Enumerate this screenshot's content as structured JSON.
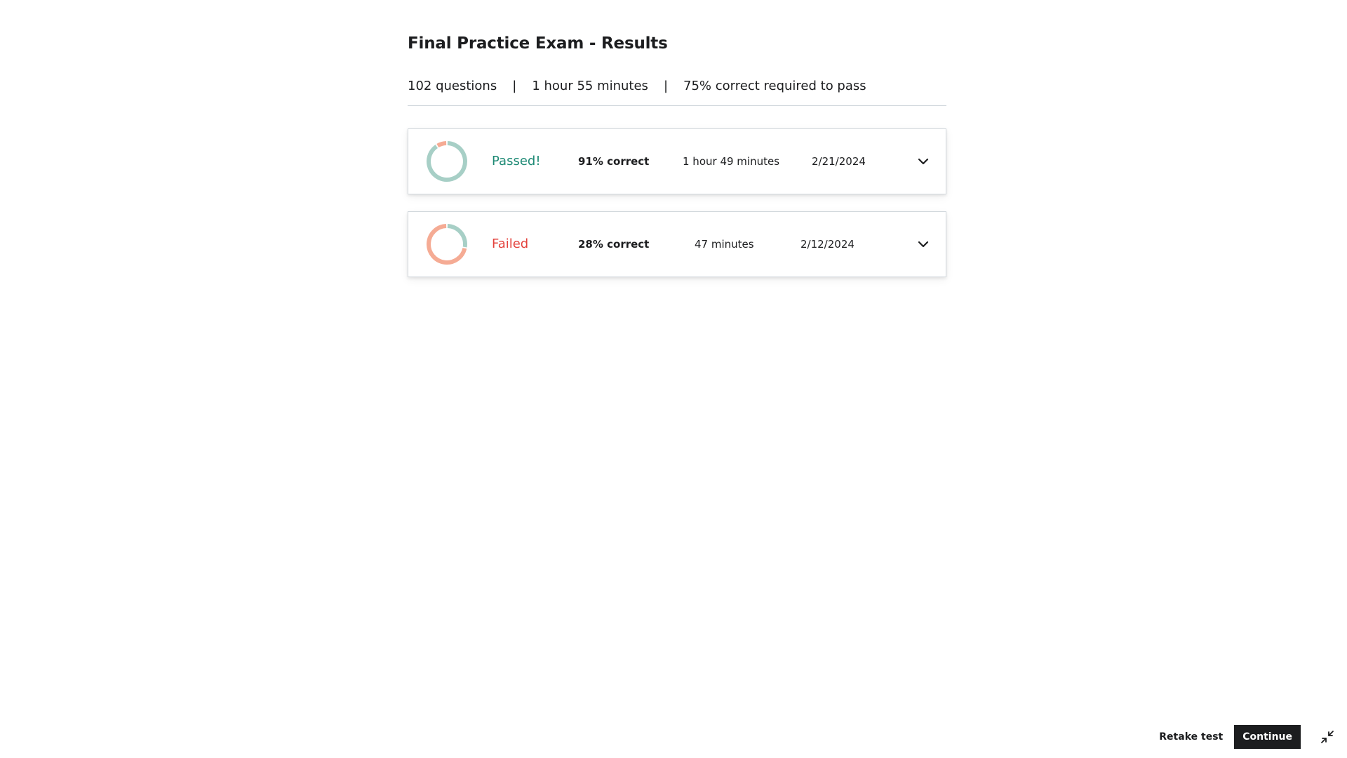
{
  "page": {
    "title": "Final Practice Exam - Results"
  },
  "meta": {
    "questions": "102 questions",
    "separator": "|",
    "duration": "1 hour 55 minutes",
    "pass_requirement": "75% correct required to pass"
  },
  "attempts": [
    {
      "status": "Passed!",
      "status_color": "#1e8a75",
      "score": "91% correct",
      "correct_fraction": 0.91,
      "duration": "1 hour 49 minutes",
      "date": "2/21/2024",
      "expand_icon": "chevron-down-icon"
    },
    {
      "status": "Failed",
      "status_color": "#e3423c",
      "score": "28% correct",
      "correct_fraction": 0.28,
      "duration": "47 minutes",
      "date": "2/12/2024",
      "expand_icon": "chevron-down-icon"
    }
  ],
  "colors": {
    "correct": "#a7cfc6",
    "incorrect": "#f5ab94"
  },
  "footer": {
    "retake_label": "Retake test",
    "continue_label": "Continue",
    "exit_fullscreen_icon": "exit-fullscreen-icon"
  }
}
